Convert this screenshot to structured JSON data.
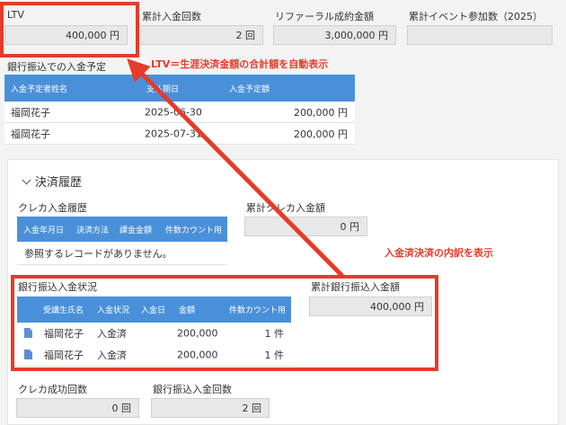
{
  "top": {
    "ltv": {
      "label": "LTV",
      "value": "400,000 円"
    },
    "payment_count": {
      "label": "累計入金回数",
      "value": "2 回"
    },
    "referral": {
      "label": "リファーラル成約金額",
      "value": "3,000,000 円"
    },
    "events": {
      "label": "累計イベント参加数（2025）",
      "value": ""
    }
  },
  "bank_schedule": {
    "title": "銀行振込での入金予定",
    "headers": [
      "入金予定者姓名",
      "支払期日",
      "入金予定額"
    ],
    "rows": [
      {
        "name": "福岡花子",
        "date": "2025-06-30",
        "amount": "200,000 円"
      },
      {
        "name": "福岡花子",
        "date": "2025-07-31",
        "amount": "200,000 円"
      }
    ]
  },
  "history": {
    "section_title": "決済履歴",
    "credit": {
      "title": "クレカ入金履歴",
      "headers": [
        "入金年月日",
        "決済方法",
        "課金金額",
        "件数カウント用"
      ],
      "empty": "参照するレコードがありません。",
      "total_label": "累計クレカ入金額",
      "total_value": "0 円"
    },
    "bank": {
      "title": "銀行振込入金状況",
      "headers": [
        "受講生氏名",
        "入金状況",
        "入金日",
        "金額",
        "件数カウント用"
      ],
      "rows": [
        {
          "name": "福岡花子",
          "status": "入金済",
          "date": "",
          "amount": "200,000",
          "count": "1 件"
        },
        {
          "name": "福岡花子",
          "status": "入金済",
          "date": "",
          "amount": "200,000",
          "count": "1 件"
        }
      ],
      "total_label": "累計銀行振込入金額",
      "total_value": "400,000 円"
    },
    "credit_success": {
      "label": "クレカ成功回数",
      "value": "0 回"
    },
    "bank_count": {
      "label": "銀行振込入金回数",
      "value": "2 回"
    }
  },
  "annotations": {
    "ltv_note": "LTV＝生涯決済金額の合計額を自動表示",
    "breakdown_note": "入金済決済の内訳を表示",
    "color": "#e53b2b"
  },
  "colors": {
    "header_blue": "#4a90d9",
    "field_bg": "#e8e8e8"
  }
}
